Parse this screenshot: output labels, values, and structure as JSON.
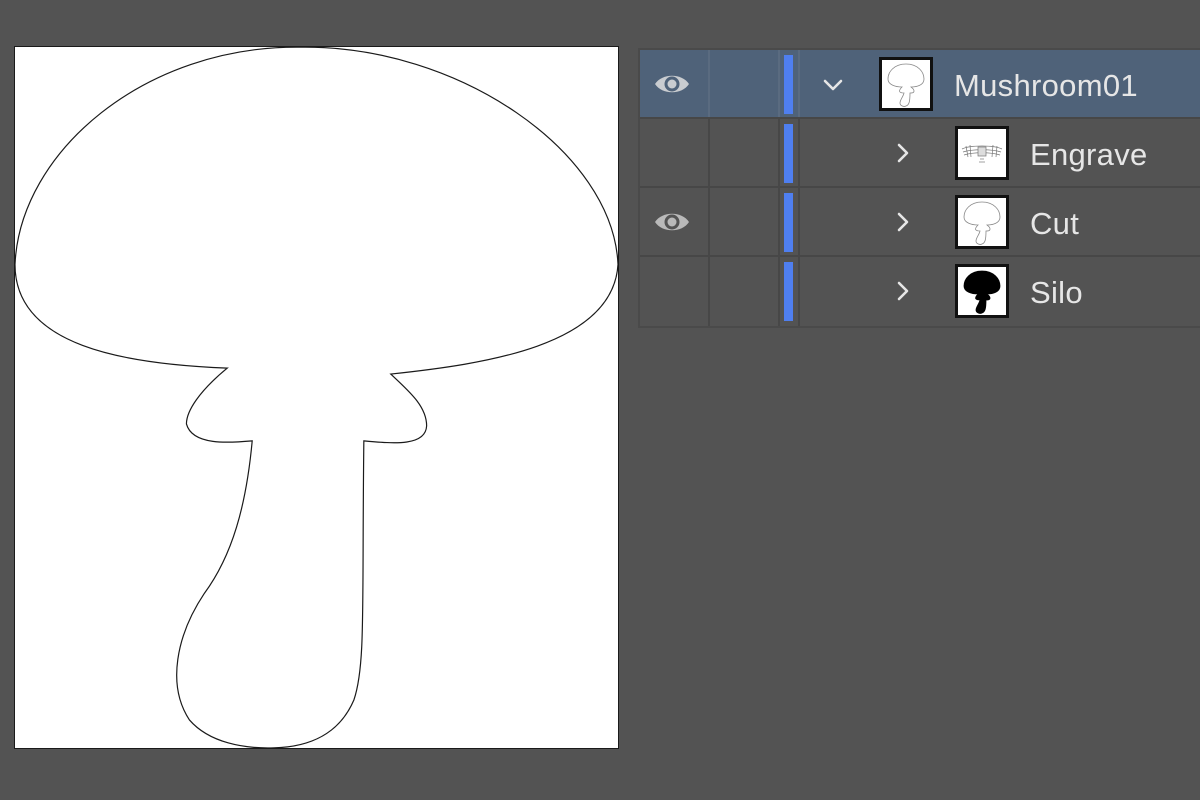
{
  "artboard": {
    "artwork": "mushroom-outline"
  },
  "layers_panel": {
    "rows": [
      {
        "name": "Mushroom01",
        "visible": true,
        "selected": true,
        "expanded": true,
        "indent": 0,
        "thumbnail": "mushroom-outline-thumbnail",
        "layer_color": "#4f7ff0"
      },
      {
        "name": "Engrave",
        "visible": false,
        "selected": false,
        "expanded": false,
        "indent": 1,
        "thumbnail": "engrave-texture-thumbnail",
        "layer_color": "#4f7ff0"
      },
      {
        "name": "Cut",
        "visible": true,
        "selected": false,
        "expanded": false,
        "indent": 1,
        "thumbnail": "mushroom-outline-thumbnail",
        "layer_color": "#4f7ff0"
      },
      {
        "name": "Silo",
        "visible": false,
        "selected": false,
        "expanded": false,
        "indent": 1,
        "thumbnail": "mushroom-silhouette-thumbnail",
        "layer_color": "#4f7ff0"
      }
    ]
  },
  "colors": {
    "panel_background": "#535353",
    "selected_row": "#4f6279",
    "layer_color": "#4f7ff0",
    "text": "#e6e6e6"
  }
}
